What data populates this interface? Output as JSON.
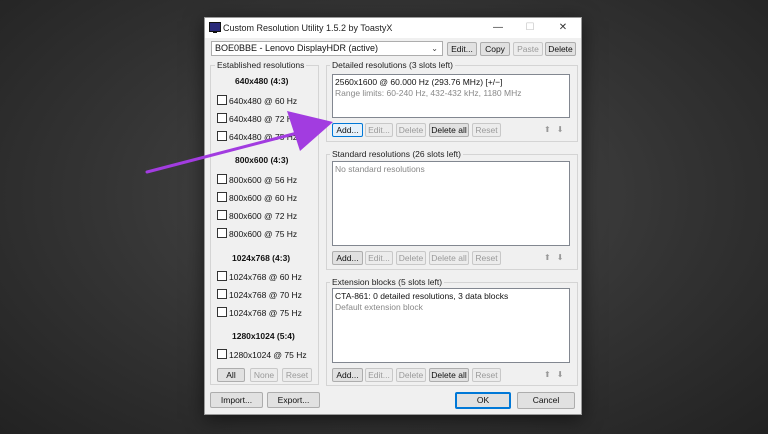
{
  "window": {
    "title": "Custom Resolution Utility 1.5.2 by ToastyX",
    "minimize": "—",
    "maximize": "☐",
    "close": "✕"
  },
  "display": {
    "selected": "BOE0BBE - Lenovo DisplayHDR (active)",
    "edit": "Edit...",
    "copy": "Copy",
    "paste": "Paste",
    "delete": "Delete"
  },
  "established": {
    "label": "Established resolutions",
    "groups": [
      {
        "heading": "640x480 (4:3)",
        "items": [
          "640x480 @ 60 Hz",
          "640x480 @ 72 Hz",
          "640x480 @ 75 Hz"
        ]
      },
      {
        "heading": "800x600 (4:3)",
        "items": [
          "800x600 @ 56 Hz",
          "800x600 @ 60 Hz",
          "800x600 @ 72 Hz",
          "800x600 @ 75 Hz"
        ]
      },
      {
        "heading": "1024x768 (4:3)",
        "items": [
          "1024x768 @ 60 Hz",
          "1024x768 @ 70 Hz",
          "1024x768 @ 75 Hz"
        ]
      },
      {
        "heading": "1280x1024 (5:4)",
        "items": [
          "1280x1024 @ 75 Hz"
        ]
      }
    ],
    "all": "All",
    "none": "None",
    "reset": "Reset"
  },
  "detailed": {
    "label": "Detailed resolutions (3 slots left)",
    "line1": "2560x1600 @ 60.000 Hz (293.76 MHz) [+/−]",
    "line2": "Range limits: 60-240 Hz, 432-432 kHz, 1180 MHz"
  },
  "standard": {
    "label": "Standard resolutions (26 slots left)",
    "empty": "No standard resolutions"
  },
  "extension": {
    "label": "Extension blocks (5 slots left)",
    "line1": "CTA-861: 0 detailed resolutions, 3 data blocks",
    "line2": "Default extension block"
  },
  "buttons": {
    "add": "Add...",
    "edit": "Edit...",
    "delete": "Delete",
    "delete_all": "Delete all",
    "reset": "Reset",
    "up": "⬆",
    "down": "⬇"
  },
  "footer": {
    "import": "Import...",
    "export": "Export...",
    "ok": "OK",
    "cancel": "Cancel"
  },
  "colors": {
    "annotation_arrow": "#a23ce0",
    "focus": "#0078d7"
  }
}
